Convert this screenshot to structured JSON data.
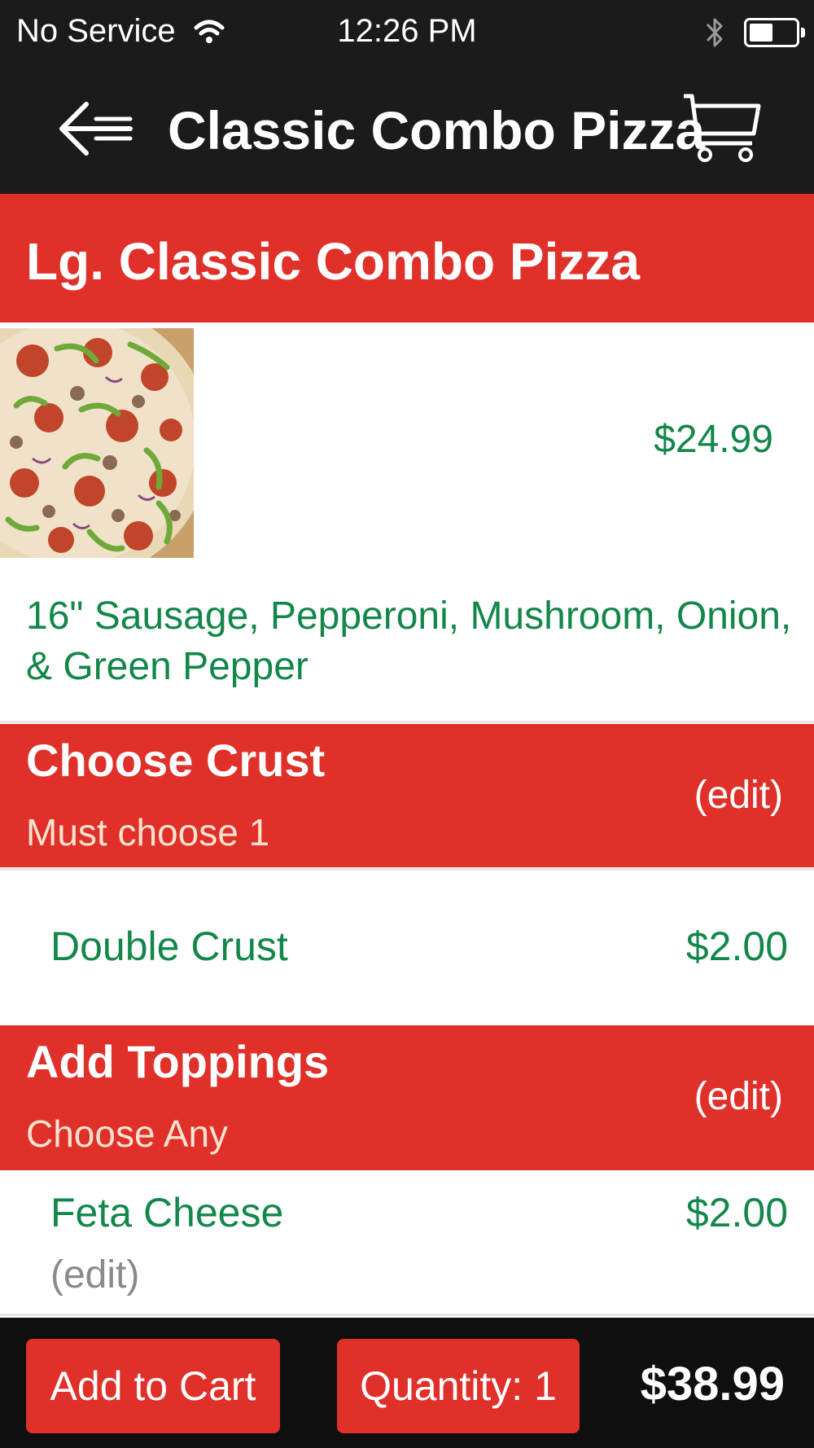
{
  "status_bar": {
    "carrier": "No Service",
    "time": "12:26 PM",
    "battery_level": 0.45
  },
  "nav": {
    "title": "Classic Combo Pizza",
    "back_icon": "back-arrow-icon",
    "cart_icon": "cart-icon"
  },
  "item": {
    "name": "Lg. Classic Combo Pizza",
    "price": "$24.99",
    "description": "16\" Sausage, Pepperoni, Mushroom, Onion, & Green Pepper",
    "image": "pizza-photo"
  },
  "sections": [
    {
      "title": "Choose Crust",
      "subtitle": "Must choose 1",
      "edit_label": "(edit)",
      "options": [
        {
          "label": "Double Crust",
          "price": "$2.00"
        }
      ]
    },
    {
      "title": "Add Toppings",
      "subtitle": "Choose Any",
      "edit_label": "(edit)",
      "options": [
        {
          "label": "Feta Cheese",
          "price": "$2.00",
          "edit_label": "(edit)"
        }
      ]
    }
  ],
  "footer": {
    "add_to_cart": "Add to Cart",
    "quantity": "Quantity: 1",
    "total": "$38.99"
  },
  "colors": {
    "accent_red": "#e0302a",
    "price_green": "#13874a",
    "bar_black": "#1b1b1b"
  }
}
